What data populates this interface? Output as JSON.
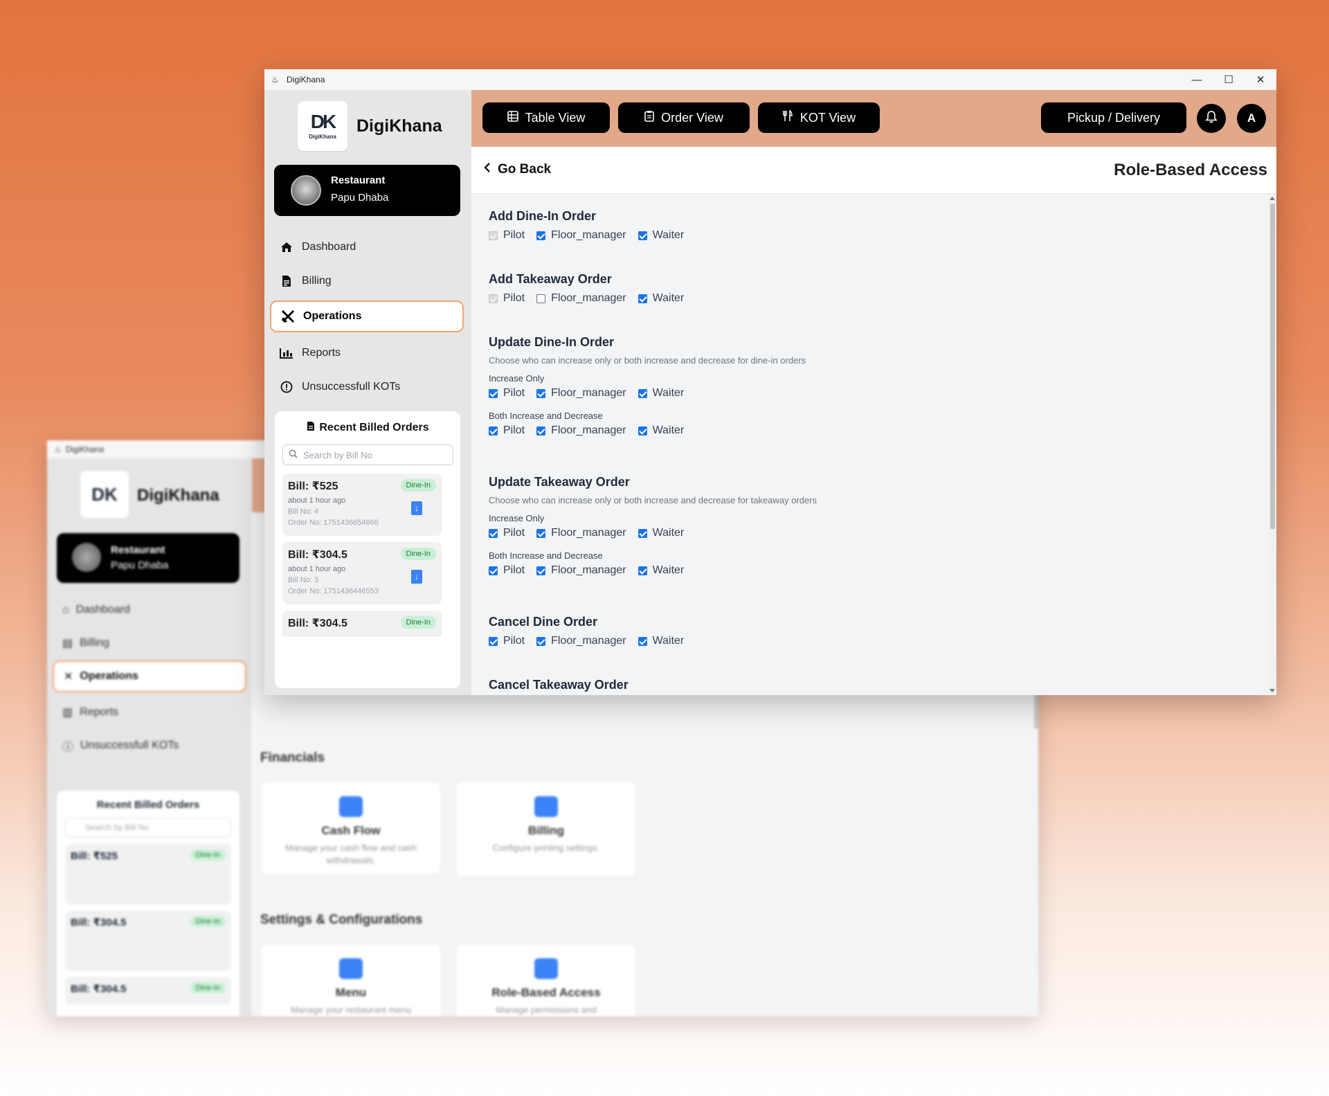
{
  "window": {
    "title": "DigiKhana",
    "app_icon": "chef-icon",
    "controls": [
      "minimize",
      "maximize",
      "close"
    ]
  },
  "sidebar": {
    "brand": "DigiKhana",
    "logo_text": "DK",
    "logo_subtext": "DigiKhana",
    "restaurant": {
      "label": "Restaurant",
      "name": "Papu Dhaba"
    },
    "nav": [
      {
        "label": "Dashboard",
        "icon": "home-icon",
        "active": false
      },
      {
        "label": "Billing",
        "icon": "receipt-icon",
        "active": false
      },
      {
        "label": "Operations",
        "icon": "tools-icon",
        "active": true
      },
      {
        "label": "Reports",
        "icon": "bar-chart-icon",
        "active": false
      },
      {
        "label": "Unsuccessfull KOTs",
        "icon": "alert-circle-icon",
        "active": false
      }
    ],
    "recent": {
      "title": "Recent Billed Orders",
      "search_placeholder": "Search by Bill No",
      "bills": [
        {
          "amount": "Bill: ₹525",
          "tag": "Dine-In",
          "time": "about 1 hour ago",
          "bill_no": "Bill No: 4",
          "order_no": "Order No: 1751436654866"
        },
        {
          "amount": "Bill: ₹304.5",
          "tag": "Dine-In",
          "time": "about 1 hour ago",
          "bill_no": "Bill No: 3",
          "order_no": "Order No: 1751436446553"
        },
        {
          "amount": "Bill: ₹304.5",
          "tag": "Dine-In",
          "time": "",
          "bill_no": "",
          "order_no": ""
        }
      ]
    }
  },
  "topbar": {
    "table_view": "Table View",
    "order_view": "Order View",
    "kot_view": "KOT View",
    "pickup_delivery": "Pickup / Delivery",
    "avatar_letter": "A"
  },
  "page": {
    "go_back": "Go Back",
    "title": "Role-Based Access",
    "roles": [
      "Pilot",
      "Floor_manager",
      "Waiter"
    ],
    "permissions": [
      {
        "title": "Add Dine-In Order",
        "desc": "",
        "groups": [
          {
            "label": "",
            "checks": [
              "disabled",
              "on",
              "on"
            ]
          }
        ]
      },
      {
        "title": "Add Takeaway Order",
        "desc": "",
        "groups": [
          {
            "label": "",
            "checks": [
              "disabled",
              "off",
              "on"
            ]
          }
        ]
      },
      {
        "title": "Update Dine-In Order",
        "desc": "Choose who can increase only or both increase and decrease for dine-in orders",
        "groups": [
          {
            "label": "Increase Only",
            "checks": [
              "on",
              "on",
              "on"
            ]
          },
          {
            "label": "Both Increase and Decrease",
            "checks": [
              "on",
              "on",
              "on"
            ]
          }
        ]
      },
      {
        "title": "Update Takeaway Order",
        "desc": "Choose who can increase only or both increase and decrease for takeaway orders",
        "groups": [
          {
            "label": "Increase Only",
            "checks": [
              "on",
              "on",
              "on"
            ]
          },
          {
            "label": "Both Increase and Decrease",
            "checks": [
              "on",
              "on",
              "on"
            ]
          }
        ]
      },
      {
        "title": "Cancel Dine Order",
        "desc": "",
        "groups": [
          {
            "label": "",
            "checks": [
              "on",
              "on",
              "on"
            ]
          }
        ]
      },
      {
        "title": "Cancel Takeaway Order",
        "desc": "",
        "groups": []
      }
    ]
  },
  "background_window": {
    "brand": "DigiKhana",
    "restaurant": {
      "label": "Restaurant",
      "name": "Papu Dhaba"
    },
    "nav": [
      "Dashboard",
      "Billing",
      "Operations",
      "Reports",
      "Unsuccessfull KOTs"
    ],
    "recent_title": "Recent Billed Orders",
    "search_placeholder": "Search by Bill No",
    "bills": [
      {
        "amount": "Bill: ₹525",
        "tag": "Dine-In"
      },
      {
        "amount": "Bill: ₹304.5",
        "tag": "Dine-In"
      },
      {
        "amount": "Bill: ₹304.5",
        "tag": "Dine-In"
      }
    ],
    "sections": [
      "Financials",
      "Settings & Configurations"
    ],
    "cards": [
      {
        "title": "Cash Flow",
        "desc": "Manage your cash flow and cash withdrawals."
      },
      {
        "title": "Billing",
        "desc": "Configure printing settings."
      },
      {
        "title": "Menu",
        "desc": "Manage your restaurant menu"
      },
      {
        "title": "Role-Based Access",
        "desc": "Manage permissions and"
      }
    ]
  },
  "colors": {
    "accent_topbar": "#e1a889",
    "active_border": "#f3a36f",
    "checkbox": "#1a73e8",
    "dine_in_tag_bg": "#c9f0d6"
  }
}
